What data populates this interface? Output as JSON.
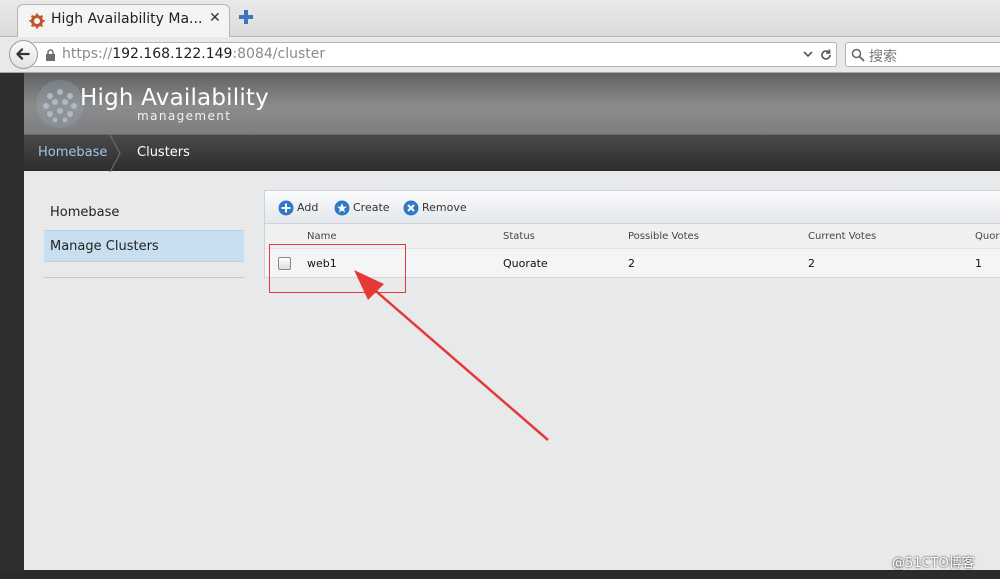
{
  "browser": {
    "tab_title": "High Availability Ma...",
    "tab_close": "✕",
    "url_scheme": "https://",
    "url_host": "192.168.122.149",
    "url_path": ":8084/cluster",
    "search_placeholder": "搜索"
  },
  "banner": {
    "title": "High Availability",
    "subtitle": "management"
  },
  "breadcrumb": {
    "home": "Homebase",
    "current": "Clusters"
  },
  "sidebar": {
    "items": [
      {
        "label": "Homebase",
        "active": false
      },
      {
        "label": "Manage Clusters",
        "active": true
      }
    ]
  },
  "toolbar": {
    "add_label": "Add",
    "create_label": "Create",
    "remove_label": "Remove"
  },
  "table": {
    "columns": [
      "Name",
      "Status",
      "Possible Votes",
      "Current Votes",
      "Quoru"
    ],
    "rows": [
      {
        "name": "web1",
        "status": "Quorate",
        "possible_votes": "2",
        "current_votes": "2",
        "quorum": "1"
      }
    ]
  },
  "watermark": "@51CTO博客",
  "colors": {
    "annotation": "#e53935",
    "breadcrumb_link": "#9fc5ea",
    "active_sidebar": "#c9dff0"
  }
}
